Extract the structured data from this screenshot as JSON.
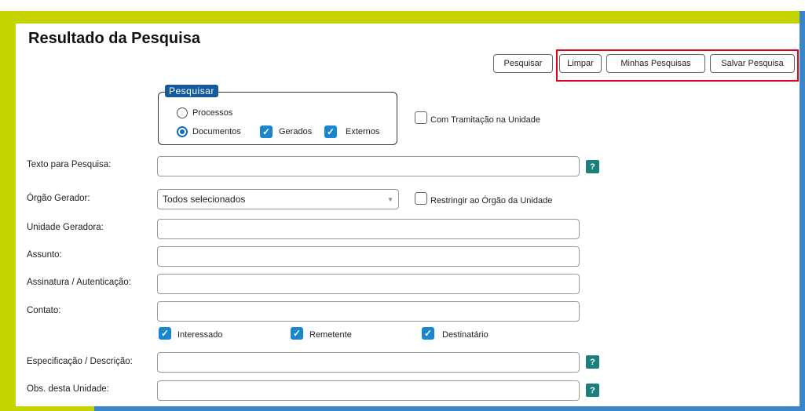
{
  "title": "Resultado da Pesquisa",
  "toolbar": {
    "pesquisar": "Pesquisar",
    "limpar": "Limpar",
    "minhas_pesquisas": "Minhas Pesquisas",
    "salvar_pesquisa": "Salvar Pesquisa"
  },
  "pesquisar_group": {
    "legend": "Pesquisar",
    "processos": "Processos",
    "documentos": "Documentos",
    "gerados": "Gerados",
    "externos": "Externos",
    "selected": "Documentos"
  },
  "com_tramitacao": "Com Tramitação na Unidade",
  "fields": {
    "texto": "Texto para Pesquisa:",
    "orgao": "Órgão Gerador:",
    "unidade": "Unidade Geradora:",
    "assunto": "Assunto:",
    "assinatura": "Assinatura / Autenticação:",
    "contato": "Contato:",
    "especificacao": "Especificação / Descrição:",
    "obs": "Obs. desta Unidade:"
  },
  "orgao_select": "Todos selecionados",
  "restringir": "Restringir ao Órgão da Unidade",
  "contato_options": {
    "interessado": "Interessado",
    "remetente": "Remetente",
    "destinatario": "Destinatário"
  },
  "help_glyph": "?",
  "check_glyph": "✓"
}
